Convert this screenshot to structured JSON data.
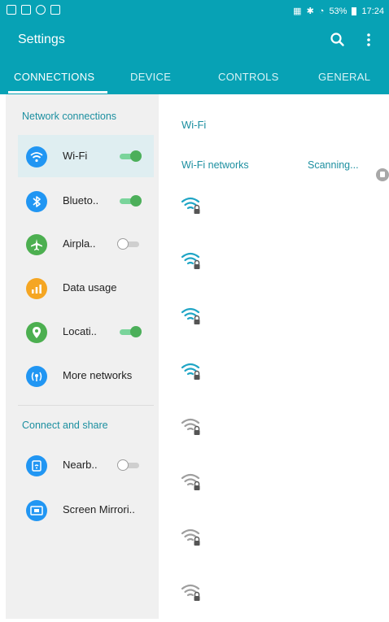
{
  "status_bar": {
    "battery": "53%",
    "time": "17:24"
  },
  "app_bar": {
    "title": "Settings"
  },
  "tabs": [
    {
      "label": "CONNECTIONS",
      "active": true
    },
    {
      "label": "DEVICE",
      "active": false
    },
    {
      "label": "CONTROLS",
      "active": false
    },
    {
      "label": "GENERAL",
      "active": false
    }
  ],
  "sections": {
    "network": "Network connections",
    "share": "Connect and share"
  },
  "items": [
    {
      "label": "Wi-Fi",
      "icon": "wifi-icon",
      "color": "#2196f3",
      "toggle": "on",
      "selected": true
    },
    {
      "label": "Blueto..",
      "icon": "bluetooth-icon",
      "color": "#2196f3",
      "toggle": "on"
    },
    {
      "label": "Airpla..",
      "icon": "airplane-icon",
      "color": "#4caf50",
      "toggle": "off"
    },
    {
      "label": "Data usage",
      "icon": "data-usage-icon",
      "color": "#f5a623",
      "toggle": null
    },
    {
      "label": "Locati..",
      "icon": "location-icon",
      "color": "#4caf50",
      "toggle": "on"
    },
    {
      "label": "More networks",
      "icon": "more-networks-icon",
      "color": "#2196f3",
      "toggle": null
    },
    {
      "label": "Nearb..",
      "icon": "nearby-devices-icon",
      "color": "#2196f3",
      "toggle": "off"
    },
    {
      "label": "Screen Mirrori..",
      "icon": "screen-mirroring-icon",
      "color": "#2196f3",
      "toggle": null
    }
  ],
  "wifi_panel": {
    "title": "Wi-Fi",
    "networks_label": "Wi-Fi networks",
    "scanning": "Scanning...",
    "networks": [
      {
        "icon": "wifi-secured-icon",
        "color": "#1fa5c5"
      },
      {
        "icon": "wifi-secured-icon",
        "color": "#1fa5c5"
      },
      {
        "icon": "wifi-secured-icon",
        "color": "#1fa5c5"
      },
      {
        "icon": "wifi-secured-icon",
        "color": "#1fa5c5"
      },
      {
        "icon": "wifi-secured-icon",
        "color": "#9e9e9e"
      },
      {
        "icon": "wifi-secured-icon",
        "color": "#9e9e9e"
      },
      {
        "icon": "wifi-secured-icon",
        "color": "#9e9e9e"
      },
      {
        "icon": "wifi-secured-icon",
        "color": "#9e9e9e"
      }
    ]
  },
  "colors": {
    "accent": "#07a2b5",
    "link": "#1c8fa0",
    "toggle_on": "#4caf5a"
  }
}
